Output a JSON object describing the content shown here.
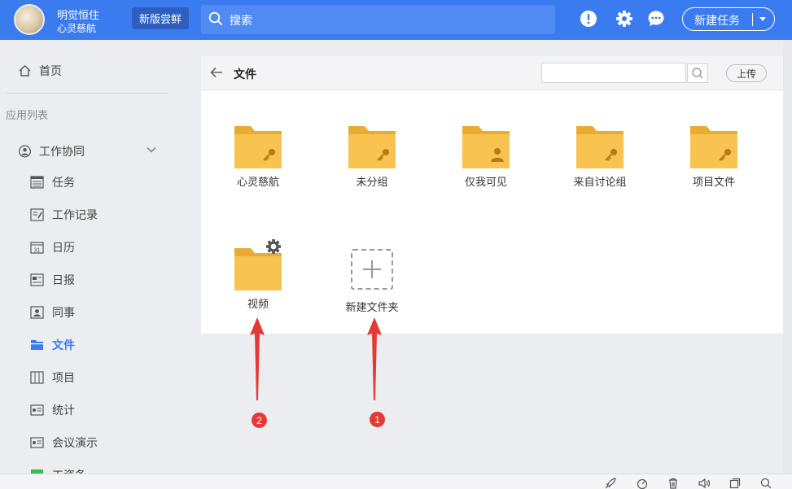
{
  "topbar": {
    "user_name": "明觉恒住",
    "user_org": "心灵慈航",
    "try_new_label": "新版尝鲜",
    "search_placeholder": "搜索",
    "new_task_label": "新建任务",
    "icons": [
      "alert-icon",
      "settings-gear-icon",
      "chat-icon"
    ]
  },
  "sidebar": {
    "home_label": "首页",
    "apps_label": "应用列表",
    "group_label": "工作协同",
    "items": [
      {
        "label": "任务",
        "icon": "task-list-icon"
      },
      {
        "label": "工作记录",
        "icon": "work-log-icon"
      },
      {
        "label": "日历",
        "icon": "calendar-icon"
      },
      {
        "label": "日报",
        "icon": "daily-report-icon"
      },
      {
        "label": "同事",
        "icon": "colleague-card-icon"
      },
      {
        "label": "文件",
        "icon": "folder-icon",
        "active": true
      },
      {
        "label": "项目",
        "icon": "project-board-icon"
      },
      {
        "label": "统计",
        "icon": "stats-card-icon"
      },
      {
        "label": "会议演示",
        "icon": "meeting-card-icon"
      },
      {
        "label": "工资条",
        "icon": "payslip-icon"
      }
    ]
  },
  "main": {
    "title": "文件",
    "search_placeholder": "",
    "upload_label": "上传",
    "folders": [
      {
        "name": "心灵慈航",
        "badge": "key"
      },
      {
        "name": "未分组",
        "badge": "key"
      },
      {
        "name": "仅我可见",
        "badge": "person"
      },
      {
        "name": "来自讨论组",
        "badge": "key"
      },
      {
        "name": "项目文件",
        "badge": "key"
      },
      {
        "name": "视频",
        "badge": "gear"
      }
    ],
    "new_folder_label": "新建文件夹"
  },
  "annotations": {
    "badge_1": "1",
    "badge_2": "2",
    "color": "#e63935"
  },
  "colors": {
    "accent": "#3a7bf0",
    "folder": "#f8c350"
  },
  "bottombar": {
    "icons": [
      "rocket-icon",
      "speed-icon",
      "trash-icon",
      "volume-icon",
      "window-icon",
      "search-icon"
    ]
  }
}
